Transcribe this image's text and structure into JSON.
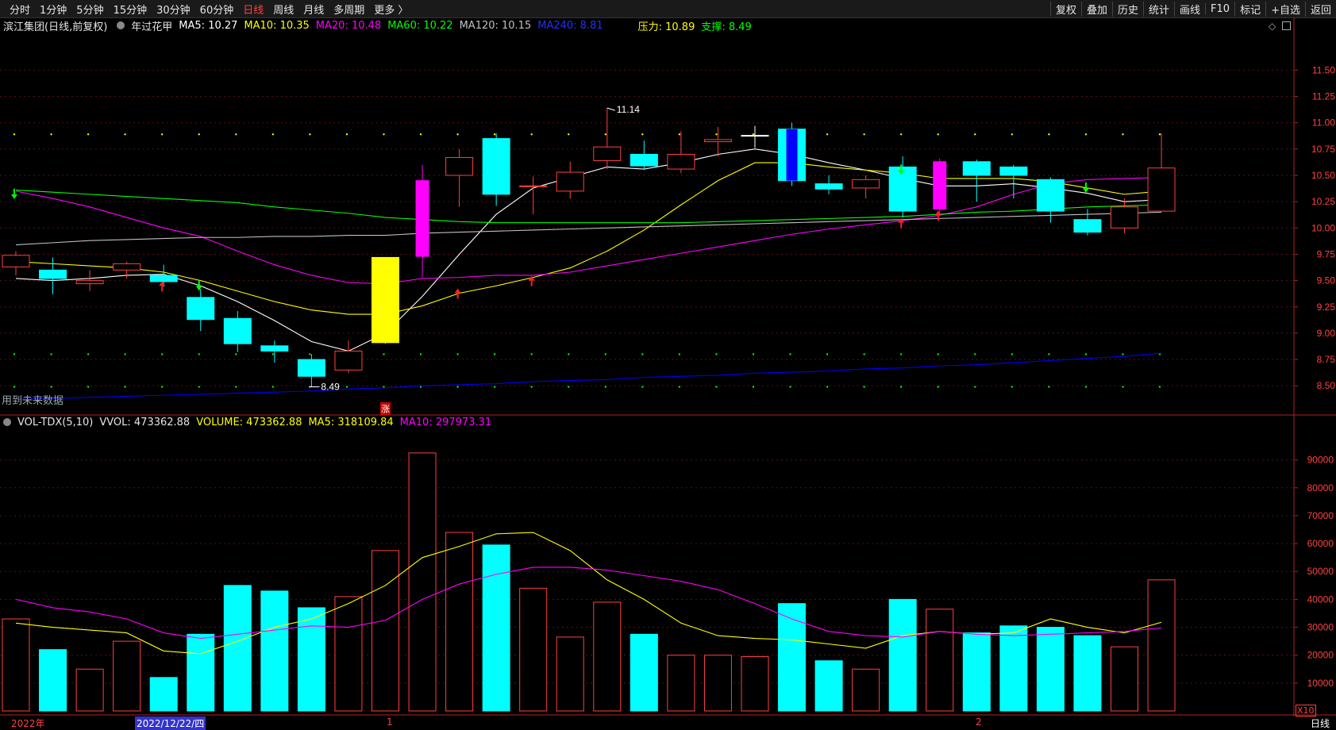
{
  "toolbar": {
    "periods": [
      "分时",
      "1分钟",
      "5分钟",
      "15分钟",
      "30分钟",
      "60分钟",
      "日线",
      "周线",
      "月线",
      "多周期",
      "更多 〉"
    ],
    "active_period": "日线",
    "right_buttons": [
      "复权",
      "叠加",
      "历史",
      "统计",
      "画线",
      "F10",
      "标记",
      "+自选",
      "返回"
    ]
  },
  "info": {
    "stock": "滨江集团(日线,前复权)",
    "indicator": "年过花甲",
    "ma5": "MA5: 10.27",
    "ma10": "MA10: 10.35",
    "ma20": "MA20: 10.48",
    "ma60": "MA60: 10.22",
    "ma120": "MA120: 10.15",
    "ma240": "MA240: 8.81",
    "pressure": "压力: 10.89",
    "support": "支撑: 8.49"
  },
  "vol_info": {
    "name": "VOL-TDX(5,10)",
    "vvol": "VVOL: 473362.88",
    "volume": "VOLUME: 473362.88",
    "ma5": "MA5: 318109.84",
    "ma10": "MA10: 297973.31"
  },
  "labels": {
    "future": "用到未来数据",
    "zhang": "涨",
    "high": "11.14",
    "low": "8.49",
    "x10": "X10"
  },
  "bottom": {
    "year": "2022年",
    "date": "2022/12/22/四",
    "m1": "1",
    "m2": "2",
    "period": "日线"
  },
  "colors": {
    "up": "#ff4040",
    "down": "#00ffff",
    "ma5": "#ffffff",
    "ma10": "#ffff00",
    "ma20": "#ff00ff",
    "ma60": "#00ff00",
    "ma120": "#c0c0c0",
    "ma240": "#0000ff"
  },
  "chart_data": {
    "type": "candlestick",
    "price_axis": {
      "ticks": [
        8.5,
        8.75,
        9.0,
        9.25,
        9.5,
        9.75,
        10.0,
        10.25,
        10.5,
        10.75,
        11.0,
        11.25,
        11.5
      ],
      "ylim": [
        8.23,
        11.85
      ]
    },
    "volume_axis": {
      "ticks": [
        10000,
        20000,
        30000,
        40000,
        50000,
        60000,
        70000,
        80000,
        90000
      ],
      "ylim": [
        0,
        99000
      ],
      "unit_label": "X10"
    },
    "candles": [
      {
        "o": 9.63,
        "h": 9.78,
        "l": 9.55,
        "c": 9.74,
        "fill": "up"
      },
      {
        "o": 9.6,
        "h": 9.72,
        "l": 9.37,
        "c": 9.52,
        "fill": "down"
      },
      {
        "o": 9.47,
        "h": 9.6,
        "l": 9.4,
        "c": 9.5,
        "fill": "up"
      },
      {
        "o": 9.6,
        "h": 9.68,
        "l": 9.52,
        "c": 9.66,
        "fill": "up"
      },
      {
        "o": 9.55,
        "h": 9.65,
        "l": 9.44,
        "c": 9.49,
        "fill": "down"
      },
      {
        "o": 9.34,
        "h": 9.42,
        "l": 9.02,
        "c": 9.13,
        "fill": "down"
      },
      {
        "o": 9.14,
        "h": 9.21,
        "l": 8.82,
        "c": 8.9,
        "fill": "down"
      },
      {
        "o": 8.88,
        "h": 8.93,
        "l": 8.72,
        "c": 8.83,
        "fill": "down"
      },
      {
        "o": 8.75,
        "h": 8.8,
        "l": 8.49,
        "c": 8.59,
        "fill": "down"
      },
      {
        "o": 8.65,
        "h": 8.93,
        "l": 8.62,
        "c": 8.83,
        "fill": "up"
      },
      {
        "o": 8.91,
        "h": 9.72,
        "l": 8.9,
        "c": 9.72,
        "fill": "yellow"
      },
      {
        "o": 9.73,
        "h": 10.6,
        "l": 9.53,
        "c": 10.45,
        "fill": "magenta"
      },
      {
        "o": 10.5,
        "h": 10.75,
        "l": 10.2,
        "c": 10.67,
        "fill": "up"
      },
      {
        "o": 10.85,
        "h": 10.9,
        "l": 10.21,
        "c": 10.32,
        "fill": "down"
      },
      {
        "o": 10.4,
        "h": 10.49,
        "l": 10.13,
        "c": 10.4,
        "fill": "up"
      },
      {
        "o": 10.35,
        "h": 10.63,
        "l": 10.28,
        "c": 10.53,
        "fill": "up"
      },
      {
        "o": 10.64,
        "h": 11.14,
        "l": 10.56,
        "c": 10.77,
        "fill": "up"
      },
      {
        "o": 10.7,
        "h": 10.83,
        "l": 10.55,
        "c": 10.59,
        "fill": "down"
      },
      {
        "o": 10.56,
        "h": 10.92,
        "l": 10.52,
        "c": 10.7,
        "fill": "up"
      },
      {
        "o": 10.82,
        "h": 10.96,
        "l": 10.68,
        "c": 10.84,
        "fill": "up"
      },
      {
        "o": 10.88,
        "h": 10.97,
        "l": 10.76,
        "c": 10.88,
        "fill": "doji"
      },
      {
        "o": 10.94,
        "h": 11.0,
        "l": 10.4,
        "c": 10.45,
        "fill": "bluecore"
      },
      {
        "o": 10.42,
        "h": 10.5,
        "l": 10.32,
        "c": 10.37,
        "fill": "down"
      },
      {
        "o": 10.38,
        "h": 10.5,
        "l": 10.28,
        "c": 10.46,
        "fill": "up"
      },
      {
        "o": 10.58,
        "h": 10.68,
        "l": 10.1,
        "c": 10.16,
        "fill": "down"
      },
      {
        "o": 10.18,
        "h": 10.66,
        "l": 10.12,
        "c": 10.63,
        "fill": "magenta"
      },
      {
        "o": 10.63,
        "h": 10.65,
        "l": 10.25,
        "c": 10.5,
        "fill": "down"
      },
      {
        "o": 10.58,
        "h": 10.6,
        "l": 10.28,
        "c": 10.5,
        "fill": "down"
      },
      {
        "o": 10.46,
        "h": 10.48,
        "l": 10.05,
        "c": 10.16,
        "fill": "down"
      },
      {
        "o": 10.08,
        "h": 10.18,
        "l": 9.93,
        "c": 9.96,
        "fill": "down"
      },
      {
        "o": 10.0,
        "h": 10.28,
        "l": 9.95,
        "c": 10.2,
        "fill": "up"
      },
      {
        "o": 10.16,
        "h": 10.9,
        "l": 10.15,
        "c": 10.57,
        "fill": "up"
      }
    ],
    "volume": [
      33000,
      22000,
      15000,
      25000,
      12000,
      27500,
      45000,
      43000,
      37000,
      41000,
      57500,
      92500,
      64000,
      59500,
      44000,
      26500,
      39000,
      27500,
      20000,
      20000,
      19500,
      38500,
      18000,
      15000,
      40000,
      36500,
      28000,
      30500,
      30000,
      27000,
      23000,
      47000
    ],
    "ma_lines": {
      "MA5": [
        9.52,
        9.5,
        9.52,
        9.55,
        9.56,
        9.45,
        9.3,
        9.12,
        8.92,
        8.83,
        9.0,
        9.35,
        9.75,
        10.13,
        10.38,
        10.48,
        10.58,
        10.56,
        10.62,
        10.7,
        10.75,
        10.7,
        10.62,
        10.55,
        10.47,
        10.4,
        10.4,
        10.42,
        10.38,
        10.33,
        10.25,
        10.27
      ],
      "MA10": [
        9.68,
        9.66,
        9.64,
        9.62,
        9.58,
        9.5,
        9.4,
        9.3,
        9.22,
        9.18,
        9.18,
        9.26,
        9.38,
        9.45,
        9.53,
        9.62,
        9.78,
        9.98,
        10.22,
        10.45,
        10.62,
        10.62,
        10.58,
        10.55,
        10.52,
        10.47,
        10.47,
        10.47,
        10.44,
        10.38,
        10.32,
        10.35
      ],
      "MA20": [
        10.35,
        10.28,
        10.2,
        10.1,
        10.0,
        9.92,
        9.78,
        9.65,
        9.55,
        9.48,
        9.47,
        9.52,
        9.53,
        9.55,
        9.55,
        9.58,
        9.64,
        9.7,
        9.76,
        9.82,
        9.88,
        9.94,
        9.99,
        10.03,
        10.07,
        10.12,
        10.2,
        10.32,
        10.42,
        10.46,
        10.47,
        10.48
      ],
      "MA60": [
        10.36,
        10.34,
        10.32,
        10.3,
        10.28,
        10.26,
        10.24,
        10.2,
        10.17,
        10.14,
        10.1,
        10.08,
        10.06,
        10.05,
        10.05,
        10.05,
        10.05,
        10.05,
        10.05,
        10.06,
        10.07,
        10.08,
        10.09,
        10.1,
        10.11,
        10.13,
        10.15,
        10.16,
        10.18,
        10.2,
        10.21,
        10.22
      ],
      "MA120": [
        9.84,
        9.86,
        9.88,
        9.89,
        9.9,
        9.91,
        9.91,
        9.92,
        9.92,
        9.93,
        9.93,
        9.95,
        9.96,
        9.97,
        9.98,
        9.99,
        10.0,
        10.01,
        10.02,
        10.03,
        10.04,
        10.05,
        10.06,
        10.07,
        10.08,
        10.09,
        10.1,
        10.11,
        10.12,
        10.13,
        10.14,
        10.15
      ],
      "MA240": [
        8.37,
        8.38,
        8.39,
        8.4,
        8.41,
        8.42,
        8.43,
        8.44,
        8.45,
        8.47,
        8.48,
        8.5,
        8.51,
        8.52,
        8.54,
        8.55,
        8.56,
        8.58,
        8.59,
        8.6,
        8.62,
        8.63,
        8.64,
        8.66,
        8.67,
        8.69,
        8.7,
        8.72,
        8.74,
        8.76,
        8.78,
        8.81
      ]
    },
    "vol_ma": {
      "MA5": [
        31500,
        30000,
        29000,
        28000,
        21500,
        20500,
        25000,
        30000,
        33000,
        38500,
        45000,
        55000,
        59000,
        63500,
        64000,
        57500,
        47000,
        40000,
        31500,
        27000,
        26000,
        25500,
        24000,
        22500,
        27000,
        28500,
        27500,
        28000,
        33000,
        30000,
        28000,
        31800
      ],
      "MA10": [
        40000,
        37000,
        35500,
        33000,
        28000,
        26000,
        27500,
        29000,
        30500,
        30000,
        32500,
        40000,
        45500,
        49000,
        51500,
        51500,
        50500,
        48500,
        46500,
        43500,
        38500,
        33000,
        28500,
        27000,
        26500,
        28500,
        27500,
        27000,
        27500,
        28000,
        28500,
        29800
      ]
    },
    "pressure": 10.89,
    "support": 8.49,
    "high_label_price": 11.14,
    "low_label_price": 8.49
  }
}
